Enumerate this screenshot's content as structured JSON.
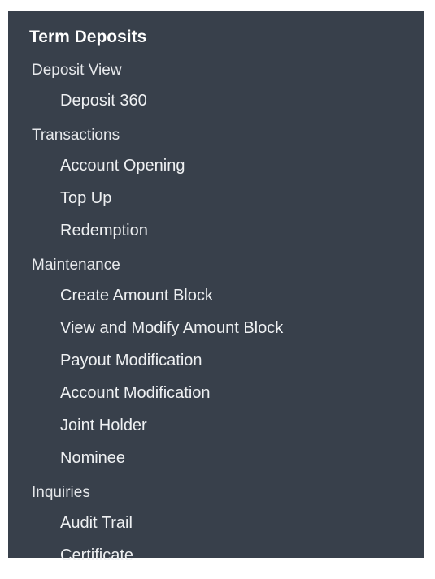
{
  "menu": {
    "title": "Term Deposits",
    "sections": [
      {
        "label": "Deposit View",
        "items": [
          "Deposit 360"
        ]
      },
      {
        "label": "Transactions",
        "items": [
          "Account Opening",
          "Top Up",
          "Redemption"
        ]
      },
      {
        "label": "Maintenance",
        "items": [
          "Create Amount Block",
          "View and Modify Amount Block",
          "Payout Modification",
          "Account Modification",
          "Joint Holder",
          "Nominee"
        ]
      },
      {
        "label": "Inquiries",
        "items": [
          "Audit Trail",
          "Certificate"
        ]
      }
    ],
    "colors": {
      "panel_background": "#38404b",
      "text": "#eef0f2"
    }
  }
}
